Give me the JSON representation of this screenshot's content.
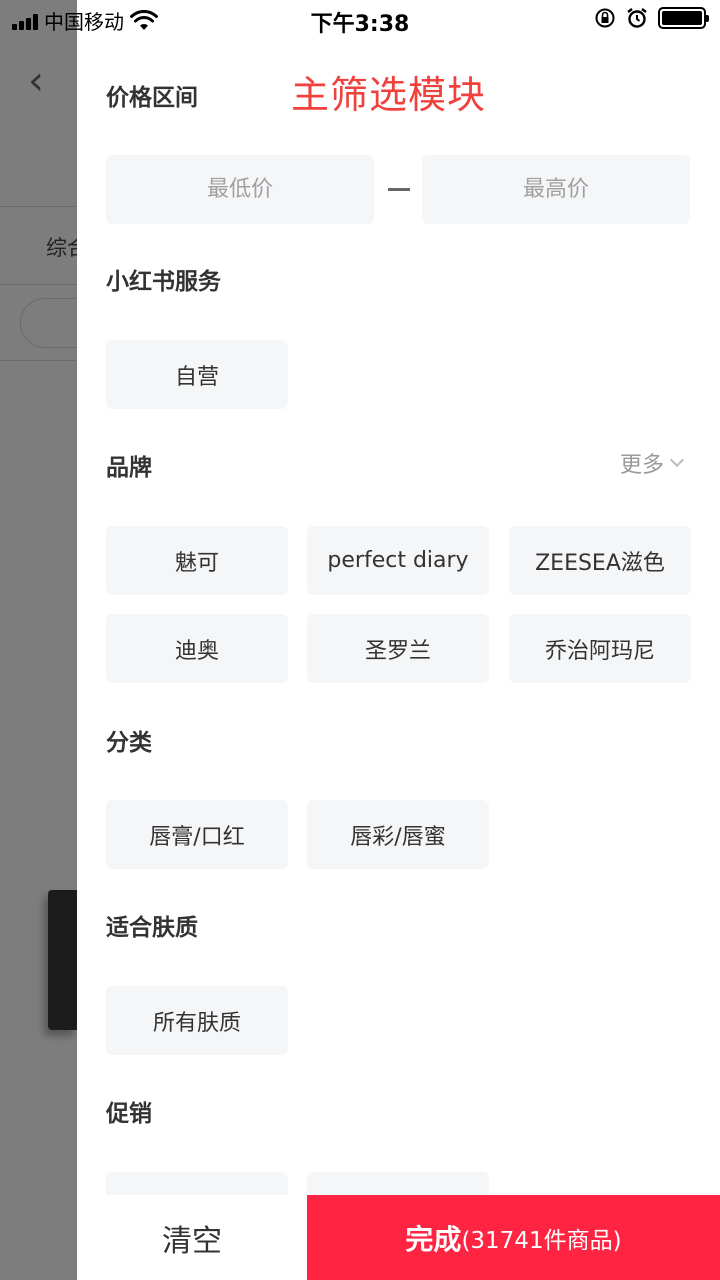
{
  "status": {
    "carrier": "中国移动",
    "time": "下午3:38"
  },
  "background": {
    "back_glyph": "‹",
    "tab_partial": "综合"
  },
  "annotation": "主筛选模块",
  "price": {
    "title": "价格区间",
    "min_placeholder": "最低价",
    "max_placeholder": "最高价"
  },
  "service": {
    "title": "小红书服务",
    "options": [
      "自营"
    ]
  },
  "brand": {
    "title": "品牌",
    "more_label": "更多",
    "options": [
      "魅可",
      "perfect diary",
      "ZEESEA滋色",
      "迪奥",
      "圣罗兰",
      "乔治阿玛尼"
    ]
  },
  "category": {
    "title": "分类",
    "options": [
      "唇膏/口红",
      "唇彩/唇蜜"
    ]
  },
  "skin": {
    "title": "适合肤质",
    "options": [
      "所有肤质"
    ]
  },
  "promo": {
    "title": "促销",
    "options": [
      "",
      ""
    ]
  },
  "footer": {
    "clear_label": "清空",
    "done_label": "完成",
    "done_count": "(31741件商品)"
  },
  "colors": {
    "accent": "#ff2442",
    "annotation": "#f0413d",
    "chip_bg": "#f4f6f8",
    "overlay": "#7d7d7d"
  },
  "icons": {
    "wifi": "wifi-icon",
    "orientation_lock": "orientation-lock-icon",
    "alarm": "alarm-icon",
    "battery": "battery-icon",
    "back": "back-icon",
    "more": "chevron-down-icon"
  }
}
